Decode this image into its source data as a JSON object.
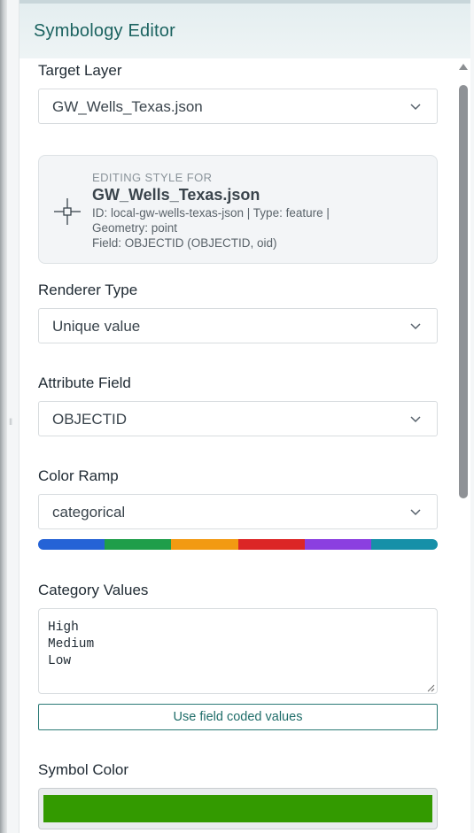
{
  "panel": {
    "title": "Symbology Editor"
  },
  "target_layer": {
    "label": "Target Layer",
    "value": "GW_Wells_Texas.json"
  },
  "info_card": {
    "heading": "EDITING STYLE FOR",
    "layer_name": "GW_Wells_Texas.json",
    "line1": "ID: local-gw-wells-texas-json | Type: feature |",
    "line2": "Geometry: point",
    "line3": "Field: OBJECTID (OBJECTID, oid)"
  },
  "renderer_type": {
    "label": "Renderer Type",
    "value": "Unique value"
  },
  "attribute_field": {
    "label": "Attribute Field",
    "value": "OBJECTID"
  },
  "color_ramp": {
    "label": "Color Ramp",
    "value": "categorical",
    "colors": [
      "#2563d6",
      "#1f9e4a",
      "#f29a12",
      "#dc2626",
      "#8b3fe0",
      "#1690a8"
    ]
  },
  "category_values": {
    "label": "Category Values",
    "text": "High\nMedium\nLow",
    "button_label": "Use field coded values"
  },
  "symbol_color": {
    "label": "Symbol Color",
    "color": "#339a00"
  },
  "icons": {
    "dropdown": "chevron-down-icon",
    "layer": "crosshair-icon",
    "scroll": "scroll-up-arrow-icon"
  }
}
